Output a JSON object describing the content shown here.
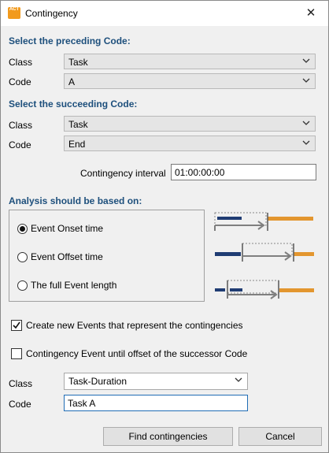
{
  "window": {
    "title": "Contingency",
    "app_icon_text": "ACT"
  },
  "preceding": {
    "heading": "Select the preceding Code:",
    "class_label": "Class",
    "class_value": "Task",
    "code_label": "Code",
    "code_value": "A"
  },
  "succeeding": {
    "heading": "Select the succeeding Code:",
    "class_label": "Class",
    "class_value": "Task",
    "code_label": "Code",
    "code_value": "End"
  },
  "interval": {
    "label": "Contingency interval",
    "value": "01:00:00:00"
  },
  "analysis": {
    "heading": "Analysis should be based on:",
    "options": [
      {
        "label": "Event Onset time",
        "selected": true
      },
      {
        "label": "Event Offset time",
        "selected": false
      },
      {
        "label": "The full Event length",
        "selected": false
      }
    ]
  },
  "checkboxes": {
    "create_events": {
      "label": "Create new Events that represent the contingencies",
      "checked": true
    },
    "until_offset": {
      "label": "Contingency Event until offset of the successor Code",
      "checked": false
    }
  },
  "result": {
    "class_label": "Class",
    "class_value": "Task-Duration",
    "code_label": "Code",
    "code_value": "Task A"
  },
  "buttons": {
    "find": "Find contingencies",
    "cancel": "Cancel"
  },
  "colors": {
    "heading": "#1d4f7c",
    "bar_dark": "#1f3c73",
    "bar_orange": "#e3962f",
    "arrow": "#7f7f7f",
    "focus_border": "#1f6cb5"
  }
}
